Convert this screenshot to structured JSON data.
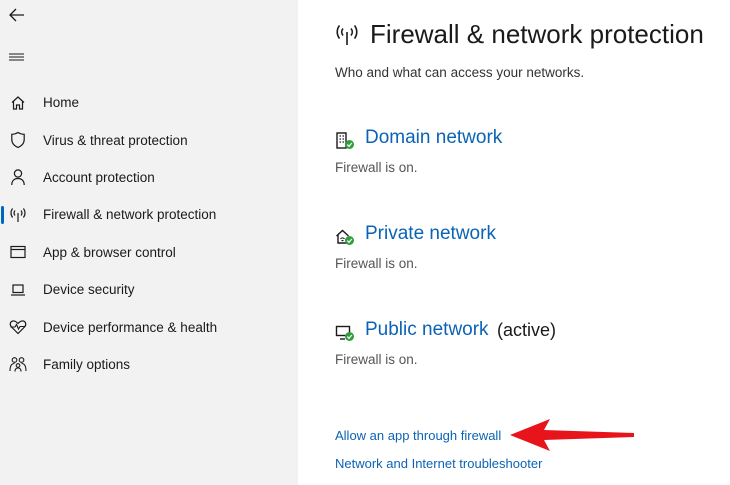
{
  "sidebar": {
    "back_icon": "back-arrow-icon",
    "menu_icon": "hamburger-icon",
    "items": [
      {
        "label": "Home",
        "icon": "home-icon"
      },
      {
        "label": "Virus & threat protection",
        "icon": "shield-icon"
      },
      {
        "label": "Account protection",
        "icon": "person-icon"
      },
      {
        "label": "Firewall & network protection",
        "icon": "antenna-icon",
        "active": true
      },
      {
        "label": "App & browser control",
        "icon": "browser-window-icon"
      },
      {
        "label": "Device security",
        "icon": "laptop-icon"
      },
      {
        "label": "Device performance & health",
        "icon": "heart-pulse-icon"
      },
      {
        "label": "Family options",
        "icon": "family-icon"
      }
    ]
  },
  "main": {
    "title": "Firewall & network protection",
    "subtitle": "Who and what can access your networks.",
    "networks": [
      {
        "name": "Domain network",
        "status": "Firewall is on.",
        "extra": ""
      },
      {
        "name": "Private network",
        "status": "Firewall is on.",
        "extra": ""
      },
      {
        "name": "Public network",
        "status": "Firewall is on.",
        "extra": "(active)"
      }
    ],
    "links": {
      "allow_app": "Allow an app through firewall",
      "troubleshooter": "Network and Internet troubleshooter"
    }
  },
  "colors": {
    "accent": "#0067c0",
    "link": "#0b63b5",
    "sidebar_bg": "#f2f2f2",
    "check_green": "#2e9e3f",
    "annotation_arrow": "#e8141b"
  }
}
